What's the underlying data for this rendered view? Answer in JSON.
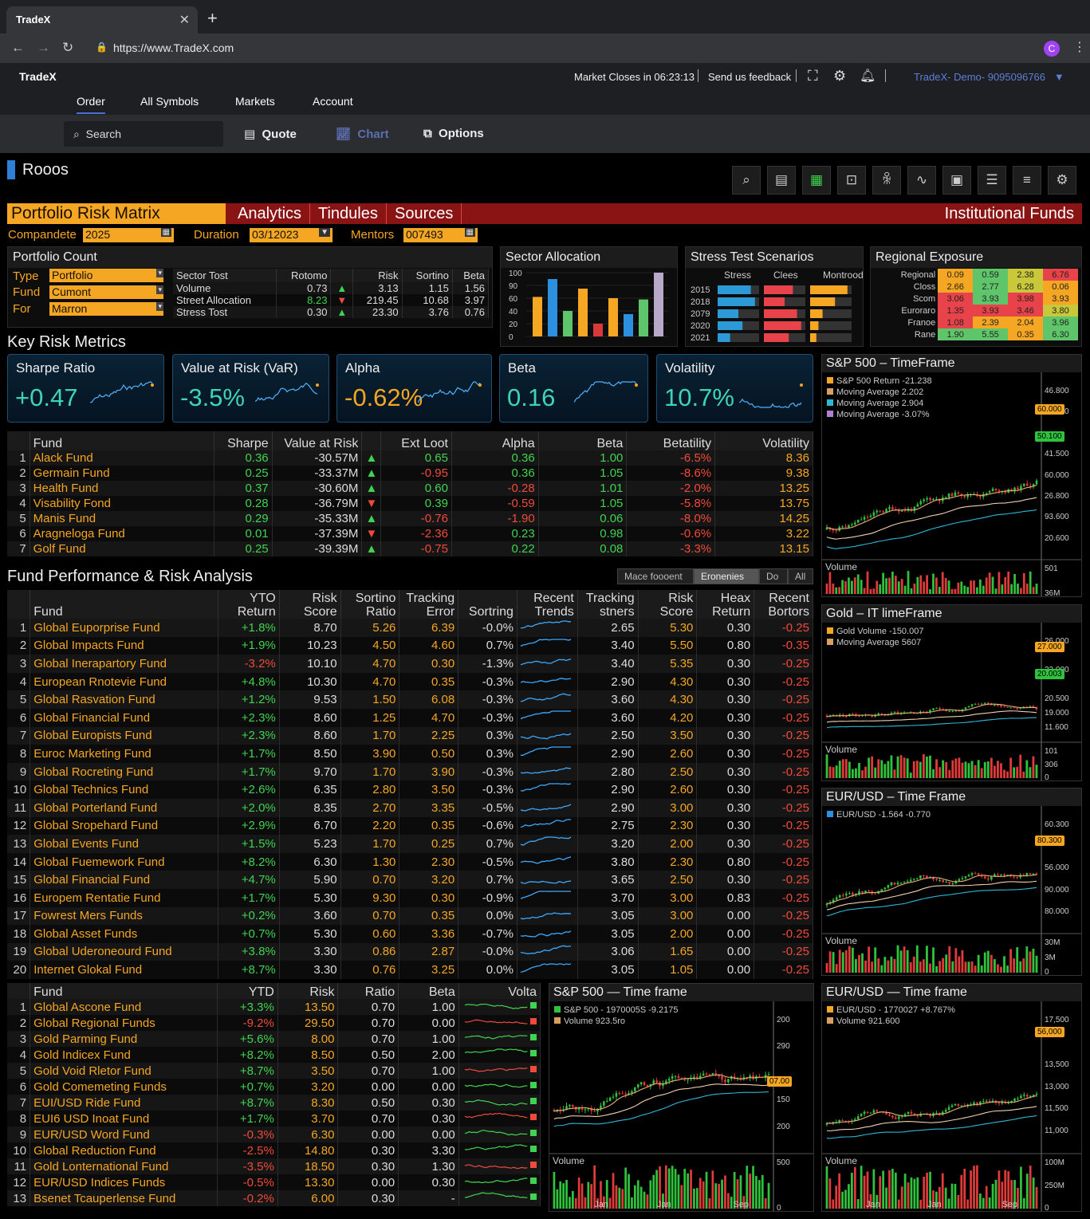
{
  "browser": {
    "tab_title": "TradeX",
    "url": "https://www.TradeX.com",
    "avatar": "C"
  },
  "header": {
    "brand": "TradeX",
    "market_close": "Market Closes in 06:23:13",
    "feedback": "Send us feedback",
    "account": "TradeX- Demo- 9095096766"
  },
  "nav": [
    "Order",
    "All Symbols",
    "Markets",
    "Account"
  ],
  "subbar": {
    "search_placeholder": "Search",
    "quote": "Quote",
    "chart": "Chart",
    "options": "Options"
  },
  "page": {
    "title": "Rooos"
  },
  "tabs": {
    "t1": "Portfolio Risk Matrix",
    "t2": "Analytics",
    "t3": "Tindules",
    "t4": "Sources",
    "right": "Institutional Funds"
  },
  "filters": {
    "l1": "Compandete",
    "v1": "2025",
    "l2": "Duration",
    "v2": "03/12023",
    "l3": "Mentors",
    "v3": "007493"
  },
  "portfolio_count": {
    "title": "Portfolio Count",
    "type_label": "Type",
    "type_value": "Portfolio",
    "fund_label": "Fund",
    "fund_value": "Cumont",
    "for_label": "For",
    "for_value": "Marron",
    "headers": [
      "Sector Tost",
      "Rotomo",
      "",
      "Risk",
      "Sortino",
      "Beta"
    ],
    "rows": [
      [
        "Volume",
        "0.73",
        "▲",
        "3.13",
        "1.15",
        "1.56"
      ],
      [
        "Street Allocation",
        "8.23",
        "▼",
        "219.45",
        "10.68",
        "3.97"
      ],
      [
        "Stress Tost",
        "0.30",
        "▲",
        "23.30",
        "3.76",
        "0.76"
      ]
    ]
  },
  "sector": {
    "title": "Sector Allocation",
    "yticks": [
      "100",
      "90",
      "60",
      "40",
      "20",
      "0"
    ]
  },
  "stress": {
    "title": "Stress Test Scenarios",
    "cols": [
      "Stress",
      "Clees",
      "Montrood"
    ],
    "years": [
      "2015",
      "2018",
      "2079",
      "2020",
      "2021"
    ]
  },
  "regional": {
    "title": "Regional Exposure",
    "rows": [
      [
        "Regional",
        "0.09",
        "0.59",
        "2.38",
        "6.76"
      ],
      [
        "Closs",
        "2.66",
        "2.77",
        "6.28",
        "0.06"
      ],
      [
        "Scom",
        "3.06",
        "3.93",
        "3.98",
        "3.93"
      ],
      [
        "Euroraro",
        "1.35",
        "3.93",
        "3.46",
        "3.80"
      ],
      [
        "Franoe",
        "1.08",
        "2.39",
        "2.04",
        "3.96"
      ],
      [
        "Rane",
        "1.90",
        "5.55",
        "0.35",
        "6.30"
      ]
    ]
  },
  "key_metrics": {
    "title": "Key Risk Metrics",
    "cards": [
      {
        "label": "Sharpe Ratio",
        "value": "+0.47"
      },
      {
        "label": "Value at Risk (VaR)",
        "value": "-3.5%"
      },
      {
        "label": "Alpha",
        "value": "-0.62%"
      },
      {
        "label": "Beta",
        "value": "0.16"
      },
      {
        "label": "Volatility",
        "value": "10.7%"
      }
    ]
  },
  "fund_table": {
    "headers": [
      "",
      "Fund",
      "Sharpe",
      "Value at Risk",
      "",
      "Ext Loot",
      "Alpha",
      "Beta",
      "Betatility",
      "Volatility"
    ],
    "rows": [
      [
        "1",
        "Alack Fund",
        "0.36",
        "-30.57M",
        "▲",
        "0.65",
        "0.36",
        "1.00",
        "-6.5%",
        "8.36"
      ],
      [
        "2",
        "Germain Fund",
        "0.25",
        "-33.37M",
        "▲",
        "-0.95",
        "0.36",
        "1.05",
        "-8.6%",
        "9.38"
      ],
      [
        "3",
        "Health Fund",
        "0.37",
        "-30.60M",
        "▲",
        "0.60",
        "-0.28",
        "1.01",
        "-2.0%",
        "13.25"
      ],
      [
        "4",
        "Visability Fond",
        "0.28",
        "-36.79M",
        "▼",
        "0.39",
        "-0.59",
        "1.05",
        "-5.8%",
        "13.75"
      ],
      [
        "5",
        "Manis Fund",
        "0.29",
        "-35.33M",
        "▲",
        "-0.76",
        "-1.90",
        "0.06",
        "-8.0%",
        "14.25"
      ],
      [
        "6",
        "Aragneloga Fund",
        "0.01",
        "-37.39M",
        "▼",
        "-2.36",
        "0.23",
        "0.98",
        "-0.6%",
        "3.22"
      ],
      [
        "7",
        "Golf Fund",
        "0.25",
        "-39.39M",
        "▲",
        "-0.75",
        "0.22",
        "0.08",
        "-3.3%",
        "13.15"
      ]
    ]
  },
  "perf": {
    "title": "Fund Performance & Risk Analysis",
    "segments": [
      "Mace foooent",
      "Eronenies",
      "Do",
      "All"
    ],
    "headers": [
      "",
      "Fund",
      "YTO Return",
      "Risk Score",
      "Sortino Ratio",
      "Tracking Error",
      "Sortring",
      "Recent Trends",
      "Tracking stners",
      "Risk Score",
      "Heax Return",
      "Recent Bortors"
    ],
    "rows": [
      [
        "1",
        "Global Euporprise Fund",
        "+1.8%",
        "8.70",
        "5.26",
        "6.39",
        "-0.0%",
        "",
        "2.65",
        "5.30",
        "0.30",
        "-0.25"
      ],
      [
        "2",
        "Global Impacts Fund",
        "+1.9%",
        "10.23",
        "4.50",
        "4.60",
        "0.7%",
        "",
        "3.40",
        "5.50",
        "0.80",
        "-0.35"
      ],
      [
        "3",
        "Global Inerapartory Fund",
        "-3.2%",
        "10.10",
        "4.70",
        "0.30",
        "-1.3%",
        "",
        "3.40",
        "5.35",
        "0.30",
        "-0.25"
      ],
      [
        "4",
        "European Rnotevie Fund",
        "+4.8%",
        "10.30",
        "4.70",
        "0.35",
        "-0.3%",
        "",
        "2.90",
        "4.30",
        "0.30",
        "-0.25"
      ],
      [
        "5",
        "Global Rasvation Fund",
        "+1.2%",
        "9.53",
        "1.50",
        "6.08",
        "-0.3%",
        "",
        "3.60",
        "4.30",
        "0.30",
        "-0.25"
      ],
      [
        "6",
        "Global Financial Fund",
        "+2.3%",
        "8.60",
        "1.25",
        "4.70",
        "-0.3%",
        "",
        "3.60",
        "4.20",
        "0.30",
        "-0.25"
      ],
      [
        "7",
        "Global Europists Fund",
        "+2.3%",
        "8.60",
        "1.70",
        "2.25",
        "0.3%",
        "",
        "2.50",
        "3.50",
        "0.30",
        "-0.25"
      ],
      [
        "8",
        "Euroc Marketing Fund",
        "+1.7%",
        "8.50",
        "3.90",
        "0.50",
        "0.3%",
        "",
        "2.90",
        "2.60",
        "0.30",
        "-0.25"
      ],
      [
        "9",
        "Global Rocreting Fund",
        "+1.7%",
        "9.70",
        "1.70",
        "3.90",
        "-0.3%",
        "",
        "2.80",
        "2.50",
        "0.30",
        "-0.25"
      ],
      [
        "10",
        "Global Technics Fund",
        "+2.6%",
        "6.35",
        "2.80",
        "3.50",
        "-0.3%",
        "",
        "2.90",
        "2.60",
        "0.30",
        "-0.25"
      ],
      [
        "11",
        "Global Porterland Fund",
        "+2.0%",
        "8.35",
        "2.70",
        "3.35",
        "-0.5%",
        "",
        "2.90",
        "3.00",
        "0.30",
        "-0.25"
      ],
      [
        "12",
        "Global Sropehard Fund",
        "+2.9%",
        "6.70",
        "2.20",
        "0.35",
        "-0.6%",
        "",
        "2.75",
        "2.30",
        "0.30",
        "-0.25"
      ],
      [
        "13",
        "Global Events Fund",
        "+1.5%",
        "5.23",
        "1.70",
        "0.25",
        "0.7%",
        "",
        "3.20",
        "2.00",
        "0.30",
        "-0.25"
      ],
      [
        "14",
        "Global Fuemework Fund",
        "+8.2%",
        "6.30",
        "1.30",
        "2.30",
        "-0.5%",
        "",
        "3.80",
        "2.30",
        "0.80",
        "-0.25"
      ],
      [
        "15",
        "Global Financial Fund",
        "+4.7%",
        "5.90",
        "0.70",
        "3.20",
        "0.7%",
        "",
        "3.65",
        "2.50",
        "0.30",
        "-0.25"
      ],
      [
        "16",
        "Europem Rentatie Fund",
        "+1.7%",
        "5.30",
        "9.30",
        "0.30",
        "-0.9%",
        "",
        "3.70",
        "3.00",
        "0.83",
        "-0.25"
      ],
      [
        "17",
        "Fowrest Mers Funds",
        "+0.2%",
        "3.60",
        "0.70",
        "0.35",
        "0.0%",
        "",
        "3.05",
        "3.00",
        "0.00",
        "-0.25"
      ],
      [
        "18",
        "Global Asset Funds",
        "+0.7%",
        "5.30",
        "0.60",
        "3.36",
        "-0.7%",
        "",
        "3.05",
        "2.00",
        "0.00",
        "-0.25"
      ],
      [
        "19",
        "Global Uderoneourd Fund",
        "+3.8%",
        "3.30",
        "0.86",
        "2.87",
        "-0.0%",
        "",
        "3.06",
        "1.65",
        "0.00",
        "-0.25"
      ],
      [
        "20",
        "Internet Glokal Fund",
        "+8.7%",
        "3.30",
        "0.76",
        "3.25",
        "0.0%",
        "",
        "3.05",
        "1.05",
        "0.00",
        "-0.25"
      ]
    ]
  },
  "bottom_table": {
    "headers": [
      "",
      "Fund",
      "YTD",
      "Risk",
      "Ratio",
      "Beta",
      "Volta"
    ],
    "rows": [
      [
        "1",
        "Global Ascone Fund",
        "+3.3%",
        "13.50",
        "0.70",
        "1.00"
      ],
      [
        "2",
        "Global Regional Funds",
        "-9.2%",
        "29.50",
        "0.70",
        "0.00"
      ],
      [
        "3",
        "Gold Parming Fund",
        "+5.6%",
        "8.00",
        "0.70",
        "1.00"
      ],
      [
        "4",
        "Gold Indicex Fund",
        "+8.2%",
        "8.50",
        "0.50",
        "2.00"
      ],
      [
        "5",
        "Gold Void Rletor Fund",
        "+8.7%",
        "3.50",
        "0.70",
        "1.00"
      ],
      [
        "6",
        "Gold Comemeting Funds",
        "+0.7%",
        "3.20",
        "0.00",
        "0.00"
      ],
      [
        "7",
        "EUI/USD Ride Fund",
        "+8.7%",
        "8.30",
        "0.50",
        "0.30"
      ],
      [
        "8",
        "EUI6 USD Inoat Fund",
        "+1.7%",
        "3.70",
        "0.70",
        "0.30"
      ],
      [
        "9",
        "EUR/USD Word Fund",
        "-0.3%",
        "6.30",
        "0.00",
        "0.00"
      ],
      [
        "10",
        "Global Reduction Fund",
        "-2.5%",
        "14.80",
        "0.30",
        "3.30"
      ],
      [
        "11",
        "Gold Lonternational Fund",
        "-3.5%",
        "18.50",
        "0.30",
        "1.30"
      ],
      [
        "12",
        "EUR/USD Indices Funds",
        "-0.5%",
        "13.30",
        "0.00",
        "0.30"
      ],
      [
        "13",
        "Bsenet Tcauperlense Fund",
        "-0.2%",
        "6.00",
        "0.30",
        "-"
      ]
    ]
  },
  "charts": {
    "sp1": {
      "title": "S&P 500 – TimeFrame",
      "legend": [
        "S&P 500 Return -21.238",
        "Moving Average 2.202",
        "Moving Average 2.904",
        "Moving Average -3.07%"
      ],
      "yticks": [
        "46.800",
        "60.000",
        "",
        "41.500",
        "60.000",
        "26.800",
        "93.600",
        "20.600"
      ],
      "tag1": "60.000",
      "tag2": "50.100",
      "volume": "Volume",
      "vticks": [
        "501",
        "36M"
      ]
    },
    "gold": {
      "title": "Gold – IT limeFrame",
      "legend": [
        "Gold Volume -150.007",
        "Moving Average 5607"
      ],
      "yticks": [
        "26.000",
        "",
        "23.000",
        "",
        "20.500",
        "19.000",
        "11.600"
      ],
      "tag1": "27.000",
      "tag2": "20.003",
      "volume": "Volume",
      "vticks": [
        "101",
        "306",
        "0"
      ]
    },
    "eur1": {
      "title": "EUR/USD – Time Frame",
      "legend": [
        "EUR/USD -1.564 -0.770"
      ],
      "yticks": [
        "60.300",
        "",
        "56.000",
        "90.000",
        "80.000"
      ],
      "tag1": "80.300",
      "volume": "Volume",
      "vticks": [
        "30M",
        "3M",
        "0"
      ]
    },
    "sp2": {
      "title": "S&P 500 — Time frame",
      "legend": [
        "S&P 500 - 1970005S -9.2175",
        "Volume 923.5ro"
      ],
      "yticks": [
        "200",
        "290",
        "",
        "150",
        "200"
      ],
      "tag1": "07.00",
      "volume": "Volume",
      "vticks": [
        "500",
        "0"
      ],
      "xticks": [
        "Jan",
        "Jan",
        "Sep"
      ]
    },
    "eur2": {
      "title": "EUR/USD — Time frame",
      "legend": [
        "EUR/USD - 1770027 +8.767%",
        "Volume 921.600"
      ],
      "yticks": [
        "17,500",
        "",
        "13,500",
        "13,000",
        "11,500",
        "11,000"
      ],
      "tag1": "56,000",
      "volume": "Volume",
      "vticks": [
        "100M",
        "250M",
        "0"
      ],
      "xticks": [
        "Jan",
        "Jan",
        "Sep"
      ]
    }
  },
  "colors": {
    "orange": "#f5a623",
    "green": "#3fd44f",
    "red": "#f04a3a",
    "tabbar": "#8a1414"
  }
}
